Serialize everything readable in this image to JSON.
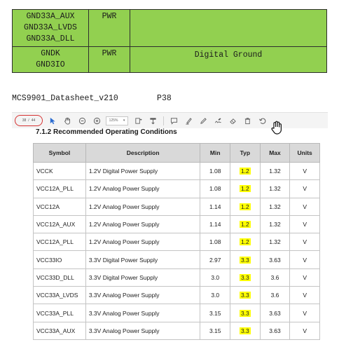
{
  "top_table": {
    "rows": [
      {
        "pins": "GND33A_AUX\nGND33A_LVDS\nGND33A_DLL",
        "type": "PWR",
        "description": ""
      },
      {
        "pins": "GNDK\nGND3IO",
        "type": "PWR",
        "description": "Digital Ground"
      }
    ],
    "color": "#92d050"
  },
  "doc_id": {
    "name": "MCS9901_Datasheet_v210",
    "page": "P38"
  },
  "toolbar": {
    "page_current": "38",
    "page_total": "44",
    "zoom": "125%",
    "icons": [
      "select-arrow-icon",
      "hand-icon",
      "zoom-out-icon",
      "zoom-in-icon",
      "zoom-dropdown",
      "fit-page-icon",
      "rotate-icon",
      "comment-icon",
      "highlight-icon",
      "draw-icon",
      "sign-icon",
      "eraser-icon",
      "delete-icon",
      "undo-icon"
    ]
  },
  "section": {
    "heading": "7.1.2  Recommended Operating Conditions"
  },
  "conditions": {
    "headers": [
      "Symbol",
      "Description",
      "Min",
      "Typ",
      "Max",
      "Units"
    ],
    "rows": [
      {
        "symbol": "VCCK",
        "description": "1.2V Digital Power Supply",
        "min": "1.08",
        "typ": "1.2",
        "max": "1.32",
        "units": "V"
      },
      {
        "symbol": "VCC12A_PLL",
        "description": "1.2V Analog Power Supply",
        "min": "1.08",
        "typ": "1.2",
        "max": "1.32",
        "units": "V"
      },
      {
        "symbol": "VCC12A",
        "description": "1.2V Analog Power Supply",
        "min": "1.14",
        "typ": "1.2",
        "max": "1.32",
        "units": "V"
      },
      {
        "symbol": "VCC12A_AUX",
        "description": "1.2V Analog Power Supply",
        "min": "1.14",
        "typ": "1.2",
        "max": "1.32",
        "units": "V"
      },
      {
        "symbol": "VCC12A_PLL",
        "description": "1.2V Analog Power Supply",
        "min": "1.08",
        "typ": "1.2",
        "max": "1.32",
        "units": "V"
      },
      {
        "symbol": "VCC33IO",
        "description": "3.3V Digital Power Supply",
        "min": "2.97",
        "typ": "3.3",
        "max": "3.63",
        "units": "V"
      },
      {
        "symbol": "VCC33D_DLL",
        "description": "3.3V Digital Power Supply",
        "min": "3.0",
        "typ": "3.3",
        "max": "3.6",
        "units": "V"
      },
      {
        "symbol": "VCC33A_LVDS",
        "description": "3.3V Analog Power Supply",
        "min": "3.0",
        "typ": "3.3",
        "max": "3.6",
        "units": "V"
      },
      {
        "symbol": "VCC33A_PLL",
        "description": "3.3V Analog Power Supply",
        "min": "3.15",
        "typ": "3.3",
        "max": "3.63",
        "units": "V"
      },
      {
        "symbol": "VCC33A_AUX",
        "description": "3.3V Analog Power Supply",
        "min": "3.15",
        "typ": "3.3",
        "max": "3.63",
        "units": "V"
      }
    ],
    "highlight_color": "#ffff00"
  }
}
